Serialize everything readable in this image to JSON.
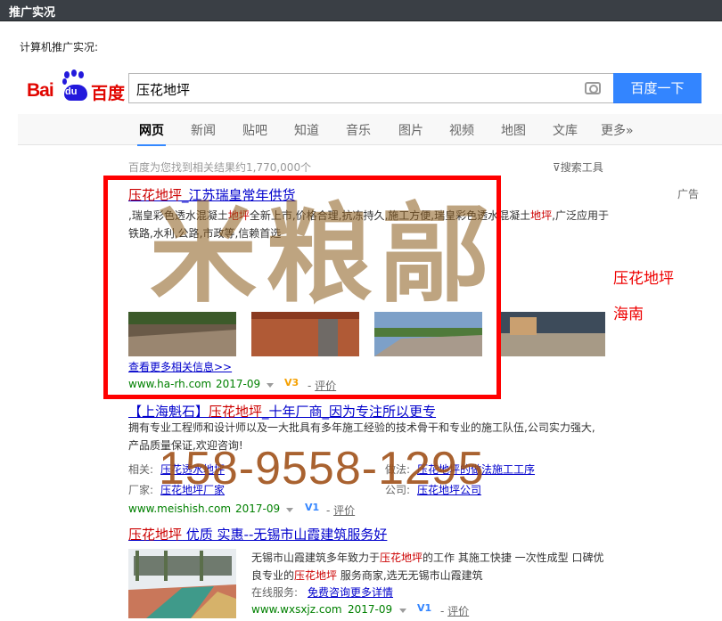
{
  "window": {
    "title": "推广实况"
  },
  "panel": {
    "subtitle": "计算机推广实况:"
  },
  "logo": {
    "bai": "Bai",
    "du": "du",
    "cn": "百度"
  },
  "search": {
    "query": "压花地坪",
    "button": "百度一下"
  },
  "tabs": [
    "网页",
    "新闻",
    "贴吧",
    "知道",
    "音乐",
    "图片",
    "视频",
    "地图",
    "文库",
    "更多»"
  ],
  "result_count": "百度为您找到相关结果约1,770,000个",
  "search_tools": "搜索工具",
  "ad_label": "广告",
  "results": [
    {
      "title_em": "压花地坪",
      "title_rest": "_江苏瑞皇常年供货",
      "abstract": [
        ",瑞皇彩色透水混凝土",
        "地坪",
        "全新上市,价格合理,抗冻持久,施工方便,瑞皇彩色透水混凝土",
        "地坪",
        ",广泛应用于铁路,水利,公路,市政等,信赖首选"
      ],
      "more_link": "查看更多相关信息>>",
      "url": "www.ha-rh.com",
      "date": "2017-09",
      "vlevel": "V3",
      "review": "评价"
    },
    {
      "title_pre": "【上海魁石】",
      "title_em": "压花地坪",
      "title_rest": "_十年厂商_因为专注所以更专",
      "abstract": "拥有专业工程师和设计师以及一大批具有多年施工经验的技术骨干和专业的施工队伍,公司实力强大,产品质量保证,欢迎咨询!",
      "related_label": "相关:",
      "related_link": "压花透水地坪",
      "method_label": "做法:",
      "method_link": "压花地坪的做法施工工序",
      "factory_label": "厂家:",
      "factory_link": "压花地坪厂家",
      "company_label": "公司:",
      "company_link": "压花地坪公司",
      "url": "www.meishish.com",
      "date": "2017-09",
      "vlevel": "V1",
      "review": "评价"
    },
    {
      "title_em": "压花地坪",
      "title_rest": " 优质 实惠--无锡市山霞建筑服务好",
      "abstract_1_pre": "无锡市山霞建筑多年致力于",
      "abstract_1_em": "压花地坪",
      "abstract_1_post": "的工作 其施工快捷 一次性成型 口碑优良专业的",
      "abstract_2_em": "压花地坪",
      "abstract_2_post": " 服务商家,选无无锡市山霞建筑",
      "service_label": "在线服务:",
      "service_link": "免费咨询更多详情",
      "url": "www.wxsxjz.com",
      "date": "2017-09",
      "vlevel": "V1",
      "review": "评价"
    }
  ],
  "side_ads": [
    "压花地坪",
    "海南"
  ],
  "watermark": {
    "seal": "米粮鄗",
    "phone": "158-9558-1295"
  },
  "colors": {
    "accent": "#3385ff",
    "highlight": "#c00",
    "link": "#00c",
    "url": "#008000",
    "box": "#ff0000"
  }
}
